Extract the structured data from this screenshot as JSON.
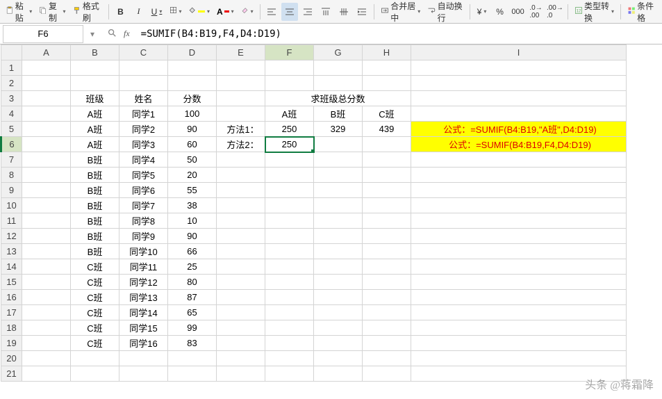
{
  "toolbar": {
    "paste": "粘贴",
    "copy": "复制",
    "format_painter": "格式刷",
    "merge_center": "合并居中",
    "wrap_text": "自动换行",
    "type_convert": "类型转换",
    "cond_format": "条件格"
  },
  "name_box": "F6",
  "formula": "=SUMIF(B4:B19,F4,D4:D19)",
  "columns": [
    "A",
    "B",
    "C",
    "D",
    "E",
    "F",
    "G",
    "H",
    "I"
  ],
  "row_count": 21,
  "headers": {
    "class": "班级",
    "name": "姓名",
    "score": "分数",
    "sum_title": "求班级总分数"
  },
  "class_cols": {
    "a": "A班",
    "b": "B班",
    "c": "C班"
  },
  "methods": {
    "m1": "方法1：",
    "m2": "方法2："
  },
  "results": {
    "f5": "250",
    "g5": "329",
    "h5": "439",
    "f6": "250"
  },
  "formulas_text": {
    "i5": "公式：=SUMIF(B4:B19,\"A班\",D4:D19)",
    "i6": "公式：=SUMIF(B4:B19,F4,D4:D19)"
  },
  "data_rows": [
    {
      "class": "A班",
      "name": "同学1",
      "score": "100"
    },
    {
      "class": "A班",
      "name": "同学2",
      "score": "90"
    },
    {
      "class": "A班",
      "name": "同学3",
      "score": "60"
    },
    {
      "class": "B班",
      "name": "同学4",
      "score": "50"
    },
    {
      "class": "B班",
      "name": "同学5",
      "score": "20"
    },
    {
      "class": "B班",
      "name": "同学6",
      "score": "55"
    },
    {
      "class": "B班",
      "name": "同学7",
      "score": "38"
    },
    {
      "class": "B班",
      "name": "同学8",
      "score": "10"
    },
    {
      "class": "B班",
      "name": "同学9",
      "score": "90"
    },
    {
      "class": "B班",
      "name": "同学10",
      "score": "66"
    },
    {
      "class": "C班",
      "name": "同学11",
      "score": "25"
    },
    {
      "class": "C班",
      "name": "同学12",
      "score": "80"
    },
    {
      "class": "C班",
      "name": "同学13",
      "score": "87"
    },
    {
      "class": "C班",
      "name": "同学14",
      "score": "65"
    },
    {
      "class": "C班",
      "name": "同学15",
      "score": "99"
    },
    {
      "class": "C班",
      "name": "同学16",
      "score": "83"
    }
  ],
  "watermark": "头条 @蒋霜降",
  "active_cell": "F6",
  "col_widths": {
    "A": 70,
    "B": 70,
    "C": 70,
    "D": 70,
    "E": 70,
    "F": 70,
    "G": 70,
    "H": 70,
    "I": 310
  }
}
